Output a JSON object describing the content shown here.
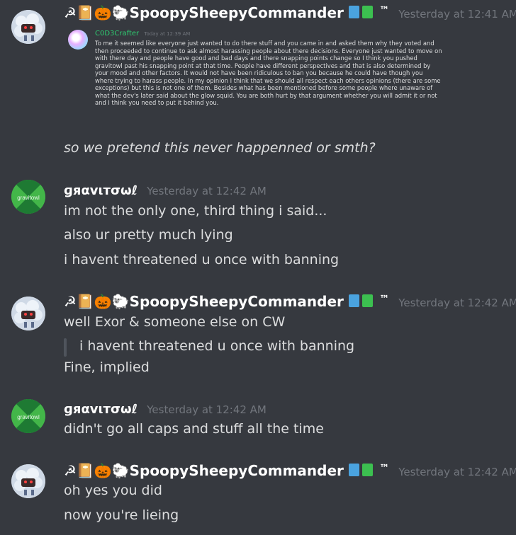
{
  "messages": [
    {
      "username": "☭📔🎃🐑SpoopySheepyCommander",
      "badges_suffix": "™",
      "timestamp": "Yesterday at 12:41 AM",
      "embed": {
        "username": "C0D3Crafter",
        "timestamp": "Today at 12:39 AM",
        "text": "To me it seemed like everyone just wanted to do there stuff and you came in and asked them why they voted and then proceeded to continue to ask almost harassing people about there decisions. Everyone just wanted to move on with there day and people have good and bad days and there snapping points change so I think you pushed gravitowl past his snapping point at that time. People have different perspectives and that is also determined by your mood and other factors. It would not have been ridiculous to ban you because he could have though you where trying to harass people. In my opinion I think that we should all respect each others opinions (there are some exceptions) but this is not one of them. Besides what has been mentioned before some people where unaware of what the dev's later said about the glow squid. You are both hurt by that argument whether you will admit it or not and I think you need to put it behind you."
      },
      "lines": [
        "so we pretend this never happenned or smth?"
      ]
    },
    {
      "username": "ɡяαvιтσωℓ",
      "timestamp": "Yesterday at 12:42 AM",
      "avatar_text": "gravitowl",
      "lines": [
        "im not the only one, third thing i said...",
        "also ur pretty much lying",
        "i havent threatened u once with banning"
      ]
    },
    {
      "username": "☭📔🎃🐑SpoopySheepyCommander",
      "badges_suffix": "™",
      "timestamp": "Yesterday at 12:42 AM",
      "lines": [
        "well Exor & someone else on CW"
      ],
      "quote": "i havent threatened u once with banning",
      "after_quote": "Fine, implied"
    },
    {
      "username": "ɡяαvιтσωℓ",
      "timestamp": "Yesterday at 12:42 AM",
      "avatar_text": "gravitowl",
      "lines": [
        "didn't go all caps and stuff all the time"
      ]
    },
    {
      "username": "☭📔🎃🐑SpoopySheepyCommander",
      "badges_suffix": "™",
      "timestamp": "Yesterday at 12:42 AM",
      "lines": [
        "oh yes you did",
        "now you're lieing"
      ]
    }
  ]
}
